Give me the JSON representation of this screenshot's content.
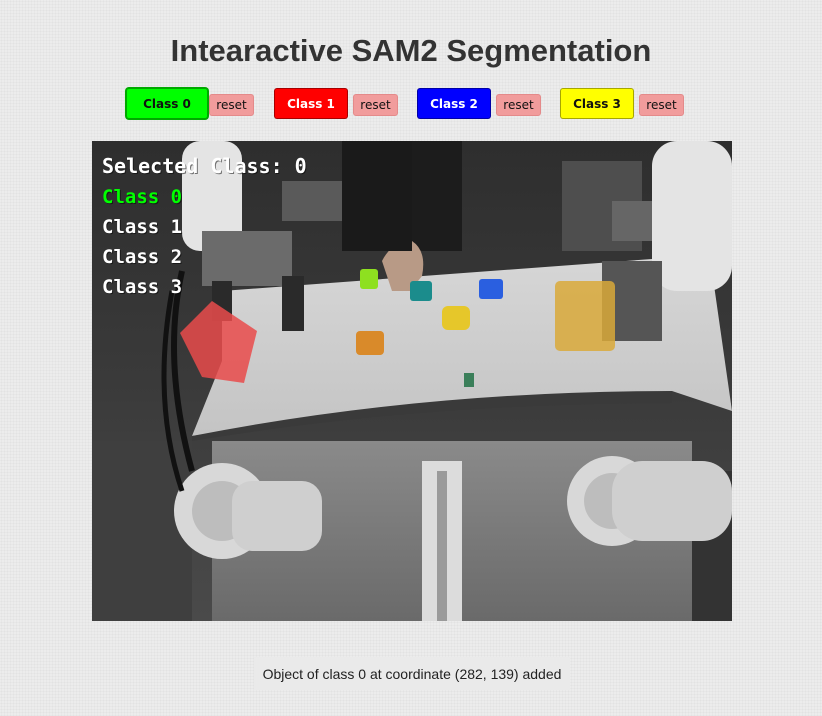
{
  "page": {
    "title": "Intearactive SAM2 Segmentation"
  },
  "toolbar": {
    "classes": [
      {
        "label": "Class 0",
        "reset_label": "reset",
        "color": "#00ff00",
        "text_color": "#111111"
      },
      {
        "label": "Class 1",
        "reset_label": "reset",
        "color": "#ff0000",
        "text_color": "#ffffff"
      },
      {
        "label": "Class 2",
        "reset_label": "reset",
        "color": "#0000ff",
        "text_color": "#ffffff"
      },
      {
        "label": "Class 3",
        "reset_label": "reset",
        "color": "#ffff00",
        "text_color": "#111111"
      }
    ]
  },
  "viewer": {
    "overlay": {
      "selected_text": "Selected Class: 0",
      "class_lines": [
        "Class 0",
        "Class 1",
        "Class 2",
        "Class 3"
      ],
      "active_color": "#00ff00",
      "inactive_color": "#ffffff"
    }
  },
  "status": {
    "message": "Object of class 0 at coordinate (282, 139) added"
  }
}
